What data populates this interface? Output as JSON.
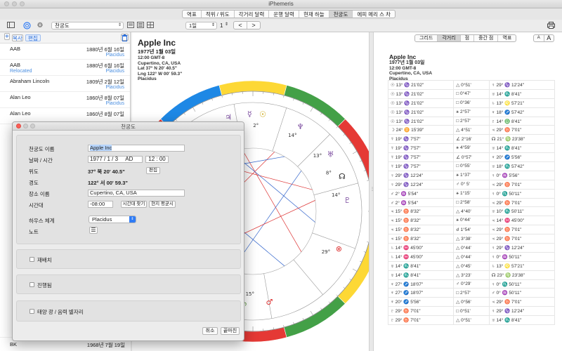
{
  "app": {
    "title": "iPhemeris"
  },
  "mode_tabs": [
    "역표",
    "적위 / 위도",
    "각거리 달력",
    "운행 달력",
    "현재 하늘",
    "천궁도",
    "에피 메리 스 차"
  ],
  "mode_active": 5,
  "toolbar": {
    "chart_select": "천궁도",
    "page_select": "1일",
    "page_number": "1",
    "prev": "<",
    "next": ">"
  },
  "sidebar": {
    "add": "+",
    "copy_label": "복사",
    "edit_label": "편집",
    "rows": [
      {
        "name": "AAB",
        "date": "1880년 6월 16일",
        "tag": "",
        "house": "Placidus"
      },
      {
        "name": "AAB",
        "date": "1880년 6월 16일",
        "tag": "Relocated",
        "house": "Placidus"
      },
      {
        "name": "Abraham Lincoln",
        "date": "1809년 2월 12일",
        "tag": "",
        "house": "Placidus"
      },
      {
        "name": "Alan Leo",
        "date": "1860년 8월 07일",
        "tag": "",
        "house": "Placidus"
      },
      {
        "name": "Alan Leo",
        "date": "1860년 8월 07일",
        "tag": "",
        "house": ""
      }
    ],
    "bottom_row": {
      "name": "BK",
      "date": "1968년 7월 19일"
    }
  },
  "chart": {
    "name": "Apple Inc",
    "date": "1977년 1월 03일",
    "lines": [
      "12:00 GMT-8",
      "Cupertino, CA, USA",
      "Lat 37° N 20' 40.5\"",
      "Lng 122° W 00' 59.3\"",
      "Placidus"
    ],
    "labels": [
      "19°13°",
      "2°",
      "14°",
      "13°",
      "8°",
      "14°",
      "29°",
      "15°"
    ]
  },
  "right": {
    "view_tabs": [
      "그리드",
      "각거리",
      "점",
      "중간 점",
      "역표"
    ],
    "view_active": 1,
    "font_small": "A",
    "font_large": "A",
    "name": "Apple Inc",
    "date": "1977년 1월 03일",
    "lines": [
      "12:00 GMT-8",
      "Cupertino, CA, USA",
      "Placidus"
    ],
    "rows": [
      [
        "☉ 13° ♑ 21'02\"",
        "△ 0°51'",
        "♀ 29° ♑ 12'24\""
      ],
      [
        "☉ 13° ♑ 21'02\"",
        "□ 0°47'",
        "♅ 14° ♏ 8'41\""
      ],
      [
        "☉ 13° ♑ 21'02\"",
        "□ 0°36'",
        "♄ 13° ♌ 57'21\""
      ],
      [
        "☉ 13° ♑ 21'02\"",
        "⚹ 2°57'",
        "♆ 18° ♐ 57'42\""
      ],
      [
        "☉ 13° ♑ 21'02\"",
        "□ 2°57'",
        "♇ 14° ♎ 8'41\""
      ],
      [
        "☽ 24° ♊ 15'39\"",
        "△ 4°51'",
        "♃ 29° ♉ 7'01\""
      ],
      [
        "☿ 19° ♑ 7'57\"",
        "∠ 2°16'",
        "☊ 21° ♍ 23'38\""
      ],
      [
        "☿ 19° ♑ 7'57\"",
        "⚹ 4°59'",
        "♅ 14° ♏ 8'41\""
      ],
      [
        "☿ 19° ♑ 7'57\"",
        "∠ 0°57'",
        "♆ 20° ♐ 5'56\""
      ],
      [
        "☿ 19° ♑ 7'57\"",
        "□ 0°55'",
        "♅ 18° ♏ 57'42\""
      ],
      [
        "♀ 29° ♑ 12'24\"",
        "⚹ 1°37'",
        "♀ 0° ♒ 5'56\""
      ],
      [
        "♀ 29° ♑ 12'24\"",
        "♂ 0° 5'",
        "♃ 29° ♉ 7'01\""
      ],
      [
        "♂ 2° ♒ 5'54\"",
        "⚹ 1°15'",
        "♀ 0° ♏ 50'11\""
      ],
      [
        "♂ 2° ♒ 5'54\"",
        "□ 2°58'",
        "♃ 29° ♉ 7'01\""
      ],
      [
        "♃ 15° ♉ 8'32\"",
        "△ 4°40'",
        "♅ 10° ♏ 50'11\""
      ],
      [
        "♃ 15° ♉ 8'32\"",
        "⚹ 0°44'",
        "♃ 14° ♓ 45'00\""
      ],
      [
        "♃ 15° ♉ 8'32\"",
        "☌ 1°54'",
        "♃ 29° ♉ 7'01\""
      ],
      [
        "♃ 15° ♉ 8'32\"",
        "△ 3°38'",
        "♃ 29° ♉ 7'01\""
      ],
      [
        "♄ 14° ♓ 45'00\"",
        "△ 0°44'",
        "♀ 29° ♑ 12'24\""
      ],
      [
        "♄ 14° ♓ 45'00\"",
        "△ 0°44'",
        "♀ 0° ♒ 50'11\""
      ],
      [
        "♅ 14° ♏ 8'41\"",
        "△ 0°45'",
        "♄ 13° ♌ 57'21\""
      ],
      [
        "♅ 14° ♏ 8'41\"",
        "△ 3°23'",
        "☊ 23° ♍ 23'38\""
      ],
      [
        "♆ 27° ♐ 18'07\"",
        "♂ 0°29'",
        "♀ 0° ♏ 50'11\""
      ],
      [
        "♆ 27° ♐ 18'07\"",
        "□ 2°57'",
        "♂ 0° ♒ 50'11\""
      ],
      [
        "♆ 20° ♐ 5'56\"",
        "△ 0°56'",
        "♃ 29° ♉ 7'01\""
      ],
      [
        "♇ 29° ♉ 7'01\"",
        "□ 0°51'",
        "♀ 29° ♑ 12'24\""
      ],
      [
        "♇ 29° ♉ 7'01\"",
        "△ 0°51'",
        "♅ 14° ♏ 8'41\""
      ]
    ]
  },
  "dialog": {
    "title": "천궁도",
    "name_label": "천궁도 이름",
    "name_value": "Apple Inc",
    "datetime_label": "날짜 / 시간",
    "year": "1977",
    "month": "1",
    "day": "3",
    "era": "AD",
    "time": "12 : 00",
    "lat_label": "위도",
    "lat_value": "37° 북 20' 40.5\"",
    "edit_btn": "편집",
    "lng_label": "경도",
    "lng_value": "122° 서 00' 59.3\"",
    "place_label": "장소 이름",
    "place_value": "Cupertino, CA, USA",
    "tz_label": "시간대",
    "tz_value": "-08:00",
    "tz_find": "시간대 찾기",
    "local_mean": "현지 평균시",
    "house_label": "하우스 체계",
    "house_value": "Placidus",
    "notes_label": "노트",
    "relocate_label": "재배치",
    "progress_label": "진행됨",
    "solar_label": "태양 광 / 음력 별자리",
    "cancel": "취소",
    "done": "끝마친"
  },
  "colors": {
    "accent": "#2f7cf6",
    "close": "#fc5f57",
    "min": "#fdbc2e",
    "max": "#28c840"
  }
}
